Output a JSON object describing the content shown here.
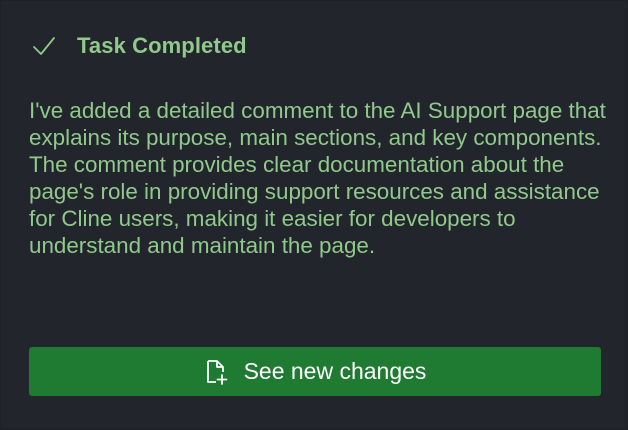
{
  "task": {
    "icon": "check-icon",
    "title": "Task Completed",
    "message": "I've added a detailed comment to the AI Support page that explains its purpose, main sections, and key components. The comment provides clear documentation about the page's role in providing support resources and assistance for Cline users, making it easier for developers to understand and maintain the page."
  },
  "action": {
    "icon": "file-plus-icon",
    "label": "See new changes"
  },
  "colors": {
    "background": "#22252b",
    "text_accent": "#8fc98b",
    "button": "#1f7a32",
    "button_text": "#ffffff"
  }
}
